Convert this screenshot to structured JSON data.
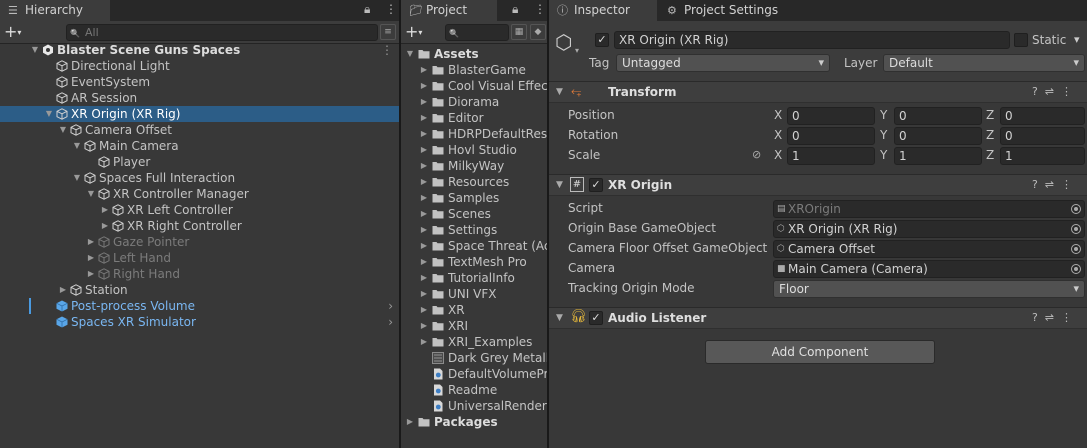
{
  "hierarchy": {
    "tab_label": "Hierarchy",
    "search_placeholder": "All",
    "rows": [
      {
        "label": "Blaster Scene Guns Spaces",
        "depth": 0,
        "fold": "open",
        "icon": "unity-scene-icon",
        "style": "scene"
      },
      {
        "label": "Directional Light",
        "depth": 1,
        "fold": "none",
        "icon": "gameobject-icon",
        "style": "normal"
      },
      {
        "label": "EventSystem",
        "depth": 1,
        "fold": "none",
        "icon": "gameobject-icon",
        "style": "normal"
      },
      {
        "label": "AR Session",
        "depth": 1,
        "fold": "none",
        "icon": "gameobject-icon",
        "style": "normal"
      },
      {
        "label": "XR Origin (XR Rig)",
        "depth": 1,
        "fold": "open",
        "icon": "gameobject-icon",
        "style": "selected"
      },
      {
        "label": "Camera Offset",
        "depth": 2,
        "fold": "open",
        "icon": "gameobject-icon",
        "style": "normal"
      },
      {
        "label": "Main Camera",
        "depth": 3,
        "fold": "open",
        "icon": "gameobject-icon",
        "style": "normal"
      },
      {
        "label": "Player",
        "depth": 4,
        "fold": "none",
        "icon": "gameobject-icon",
        "style": "normal"
      },
      {
        "label": "Spaces Full Interaction",
        "depth": 3,
        "fold": "open",
        "icon": "gameobject-icon",
        "style": "normal"
      },
      {
        "label": "XR Controller Manager",
        "depth": 4,
        "fold": "open",
        "icon": "gameobject-icon",
        "style": "normal"
      },
      {
        "label": "XR Left Controller",
        "depth": 5,
        "fold": "closed",
        "icon": "gameobject-icon",
        "style": "normal"
      },
      {
        "label": "XR Right Controller",
        "depth": 5,
        "fold": "closed",
        "icon": "gameobject-icon",
        "style": "normal"
      },
      {
        "label": "Gaze Pointer",
        "depth": 4,
        "fold": "closed",
        "icon": "gameobject-icon",
        "style": "disabled"
      },
      {
        "label": "Left Hand",
        "depth": 4,
        "fold": "closed",
        "icon": "gameobject-icon",
        "style": "disabled"
      },
      {
        "label": "Right Hand",
        "depth": 4,
        "fold": "closed",
        "icon": "gameobject-icon",
        "style": "disabled"
      },
      {
        "label": "Station",
        "depth": 2,
        "fold": "closed",
        "icon": "gameobject-icon",
        "style": "normal"
      },
      {
        "label": "Post-process Volume",
        "depth": 1,
        "fold": "none",
        "icon": "prefab-icon",
        "style": "prefab",
        "chevron": true,
        "bar": true
      },
      {
        "label": "Spaces XR Simulator",
        "depth": 1,
        "fold": "none",
        "icon": "prefab-icon",
        "style": "prefab",
        "chevron": true
      }
    ]
  },
  "project": {
    "tab_label": "Project",
    "rows": [
      {
        "label": "Assets",
        "type": "folder-open",
        "depth": 0
      },
      {
        "label": "BlasterGame",
        "type": "folder",
        "depth": 1
      },
      {
        "label": "Cool Visual Effect",
        "type": "folder",
        "depth": 1
      },
      {
        "label": "Diorama",
        "type": "folder",
        "depth": 1
      },
      {
        "label": "Editor",
        "type": "folder",
        "depth": 1
      },
      {
        "label": "HDRPDefaultReso",
        "type": "folder",
        "depth": 1
      },
      {
        "label": "Hovl Studio",
        "type": "folder",
        "depth": 1
      },
      {
        "label": "MilkyWay",
        "type": "folder",
        "depth": 1
      },
      {
        "label": "Resources",
        "type": "folder",
        "depth": 1
      },
      {
        "label": "Samples",
        "type": "folder",
        "depth": 1
      },
      {
        "label": "Scenes",
        "type": "folder",
        "depth": 1
      },
      {
        "label": "Settings",
        "type": "folder",
        "depth": 1
      },
      {
        "label": "Space Threat (Ac",
        "type": "folder",
        "depth": 1
      },
      {
        "label": "TextMesh Pro",
        "type": "folder",
        "depth": 1
      },
      {
        "label": "TutorialInfo",
        "type": "folder",
        "depth": 1
      },
      {
        "label": "UNI VFX",
        "type": "folder",
        "depth": 1
      },
      {
        "label": "XR",
        "type": "folder",
        "depth": 1
      },
      {
        "label": "XRI",
        "type": "folder",
        "depth": 1
      },
      {
        "label": "XRI_Examples",
        "type": "folder",
        "depth": 1
      },
      {
        "label": "Dark Grey Metalli",
        "type": "material",
        "depth": 1
      },
      {
        "label": "DefaultVolumePro",
        "type": "asset",
        "depth": 1
      },
      {
        "label": "Readme",
        "type": "asset",
        "depth": 1
      },
      {
        "label": "UniversalRenderP",
        "type": "asset",
        "depth": 1
      },
      {
        "label": "Packages",
        "type": "folder",
        "depth": 0
      }
    ]
  },
  "inspector": {
    "tab_label": "Inspector",
    "settings_tab_label": "Project Settings",
    "object_name": "XR Origin (XR Rig)",
    "static_label": "Static",
    "tag_label": "Tag",
    "tag_value": "Untagged",
    "layer_label": "Layer",
    "layer_value": "Default",
    "transform": {
      "title": "Transform",
      "position_label": "Position",
      "rotation_label": "Rotation",
      "scale_label": "Scale",
      "position": {
        "x": "0",
        "y": "0",
        "z": "0"
      },
      "rotation": {
        "x": "0",
        "y": "0",
        "z": "0"
      },
      "scale": {
        "x": "1",
        "y": "1",
        "z": "1"
      }
    },
    "xr_origin": {
      "title": "XR Origin",
      "script_label": "Script",
      "script_value": "XROrigin",
      "origin_base_label": "Origin Base GameObject",
      "origin_base_value": "XR Origin (XR Rig)",
      "camera_floor_label": "Camera Floor Offset GameObject",
      "camera_floor_value": "Camera Offset",
      "camera_label": "Camera",
      "camera_value": "Main Camera (Camera)",
      "tracking_label": "Tracking Origin Mode",
      "tracking_value": "Floor"
    },
    "audio_listener": {
      "title": "Audio Listener"
    },
    "add_component_label": "Add Component",
    "axis_labels": {
      "x": "X",
      "y": "Y",
      "z": "Z"
    }
  },
  "colors": {
    "selection": "#2c5d87",
    "prefab": "#7ab7f2",
    "panel": "#383838"
  }
}
